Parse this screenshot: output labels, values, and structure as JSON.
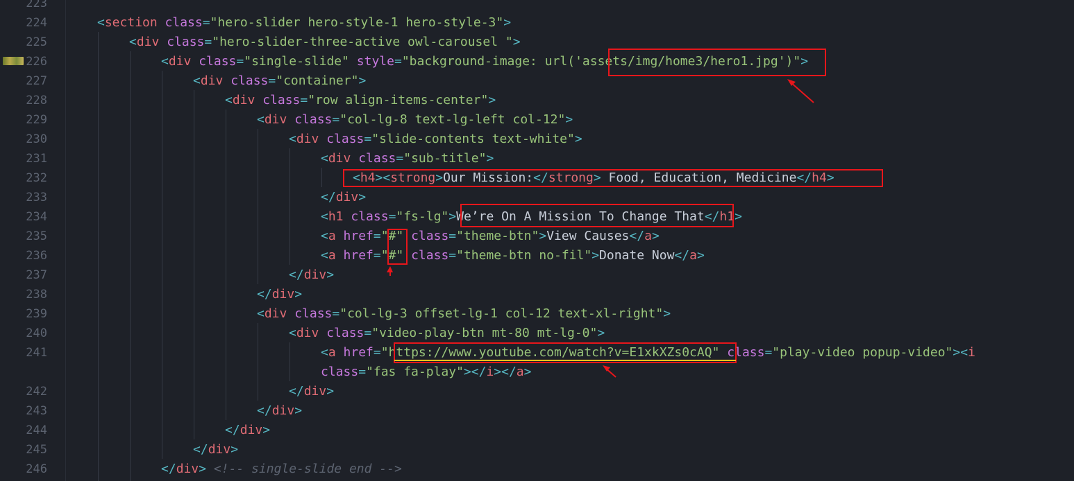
{
  "gutter": {
    "line_numbers": [
      "223",
      "224",
      "225",
      "226",
      "227",
      "228",
      "229",
      "230",
      "231",
      "232",
      "233",
      "234",
      "235",
      "236",
      "237",
      "238",
      "239",
      "240",
      "241",
      "242",
      "243",
      "244",
      "245",
      "246"
    ]
  },
  "code": {
    "l224": {
      "tag": "section",
      "attr": "class",
      "val": "\"hero-slider hero-style-1 hero-style-3\""
    },
    "l225": {
      "tag": "div",
      "attr": "class",
      "val": "\"hero-slider-three-active owl-carousel \""
    },
    "l226": {
      "tag": "div",
      "attr1": "class",
      "val1": "\"single-slide\"",
      "attr2": "style",
      "val2a": "\"background-image: url('",
      "val2b": "assets/img/home3/hero1.jpg",
      "val2c": "')\""
    },
    "l227": {
      "tag": "div",
      "attr": "class",
      "val": "\"container\""
    },
    "l228": {
      "tag": "div",
      "attr": "class",
      "val": "\"row align-items-center\""
    },
    "l229": {
      "tag": "div",
      "attr": "class",
      "val": "\"col-lg-8 text-lg-left col-12\""
    },
    "l230": {
      "tag": "div",
      "attr": "class",
      "val": "\"slide-contents text-white\""
    },
    "l231": {
      "tag": "div",
      "attr": "class",
      "val": "\"sub-title\""
    },
    "l232": {
      "tag_h4": "h4",
      "tag_strong": "strong",
      "strong_text": "Our Mission:",
      "rest_text": " Food, Education, Medicine"
    },
    "l233": {
      "tag": "div"
    },
    "l234": {
      "tag": "h1",
      "attr": "class",
      "val": "\"fs-lg\"",
      "text": "We’re On A Mission To Change That"
    },
    "l235": {
      "tag": "a",
      "attr1": "href",
      "val1": "\"#\"",
      "attr2": "class",
      "val2": "\"theme-btn\"",
      "text": "View Causes"
    },
    "l236": {
      "tag": "a",
      "attr1": "href",
      "val1": "\"#\"",
      "attr2": "class",
      "val2": "\"theme-btn no-fil\"",
      "text": "Donate Now"
    },
    "l237": {
      "tag": "div"
    },
    "l238": {
      "tag": "div"
    },
    "l239": {
      "tag": "div",
      "attr": "class",
      "val": "\"col-lg-3 offset-lg-1 col-12 text-xl-right\""
    },
    "l240": {
      "tag": "div",
      "attr": "class",
      "val": "\"video-play-btn mt-80 mt-lg-0\""
    },
    "l241": {
      "tag": "a",
      "attr1": "href",
      "q": "\"",
      "url": "https://www.youtube.com/watch?v=E1xkXZs0cAQ",
      "attr2": "class",
      "val2": "\"play-video popup-video\"",
      "tag_i": "i"
    },
    "l241b": {
      "attr": "class",
      "val": "\"fas fa-play\"",
      "tag_i": "i",
      "tag_a": "a"
    },
    "l242": {
      "tag": "div"
    },
    "l243": {
      "tag": "div"
    },
    "l244": {
      "tag": "div"
    },
    "l245": {
      "tag": "div"
    },
    "l246": {
      "tag": "div",
      "comment": "<!-- single-slide end -->"
    }
  },
  "colors": {
    "background": "#1e2128",
    "annotation_box": "#e8161b",
    "underline": "#f0c419"
  }
}
